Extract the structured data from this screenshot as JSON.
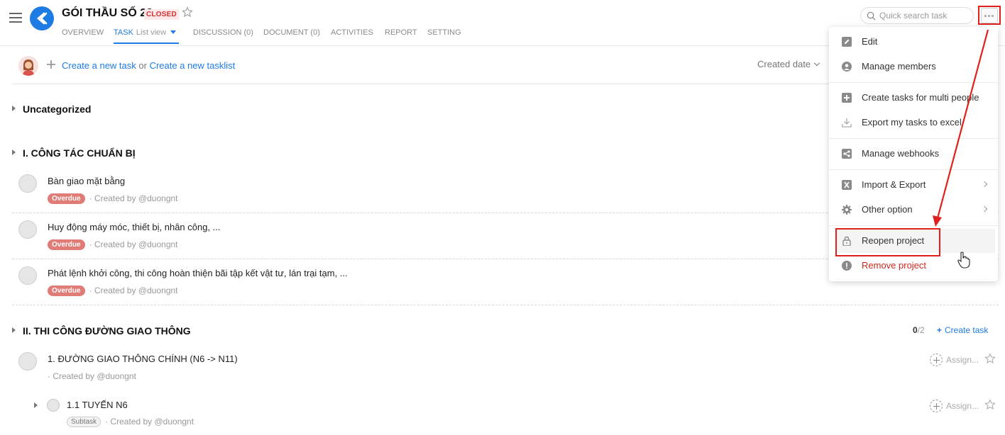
{
  "project": {
    "title": "GÓI THẦU SỐ 28",
    "status_badge": "CLOSED"
  },
  "nav": {
    "tabs": [
      {
        "label": "OVERVIEW"
      },
      {
        "label": "TASK",
        "sub": "List view",
        "active": true
      },
      {
        "label": "DISCUSSION (0)"
      },
      {
        "label": "DOCUMENT (0)"
      },
      {
        "label": "ACTIVITIES"
      },
      {
        "label": "REPORT"
      },
      {
        "label": "SETTING"
      }
    ]
  },
  "search": {
    "placeholder": "Quick search task"
  },
  "toolbar": {
    "create_task": "Create a new task",
    "or": "or",
    "create_tasklist": "Create a new tasklist",
    "sort_label": "Created date"
  },
  "groups": [
    {
      "title": "Uncategorized",
      "tasks": []
    },
    {
      "title": "I. CÔNG TÁC CHUẨN BỊ",
      "tasks": [
        {
          "name": "Bàn giao mặt bằng",
          "badge": "Overdue",
          "meta": "· Created by @duongnt"
        },
        {
          "name": "Huy động máy móc, thiết bị, nhân công, ...",
          "badge": "Overdue",
          "meta": "· Created by @duongnt"
        },
        {
          "name": "Phát lệnh khởi công, thi công hoàn thiện bãi tập kết vật tư, lán trại tạm, ...",
          "badge": "Overdue",
          "meta": "· Created by @duongnt"
        }
      ]
    },
    {
      "title": "II. THI CÔNG ĐƯỜNG GIAO THÔNG",
      "progress_done": "0",
      "progress_total": "/2",
      "create_task": "Create task",
      "tasks": [
        {
          "name": "1. ĐƯỜNG GIAO THÔNG CHÍNH (N6 -> N11)",
          "meta": "· Created by @duongnt",
          "assign": "Assign..."
        },
        {
          "name": "1.1 TUYẾN N6",
          "badge": "Subtask",
          "meta": "· Created by @duongnt",
          "assign": "Assign..."
        }
      ]
    }
  ],
  "menu": {
    "items": [
      {
        "label": "Edit",
        "icon": "pencil-icon"
      },
      {
        "label": "Manage members",
        "icon": "person-circle-icon"
      },
      {
        "label": "Create tasks for multi people",
        "icon": "plus-square-icon"
      },
      {
        "label": "Export my tasks to excel",
        "icon": "download-icon"
      },
      {
        "label": "Manage webhooks",
        "icon": "share-icon"
      },
      {
        "label": "Import & Export",
        "icon": "xls-icon"
      },
      {
        "label": "Other option",
        "icon": "gear-icon"
      },
      {
        "label": "Reopen project",
        "icon": "lock-icon"
      },
      {
        "label": "Remove project",
        "icon": "alert-icon"
      }
    ]
  },
  "colors": {
    "accent": "#1e7be3",
    "annotation_red": "#e0201b",
    "overdue": "#e07b76",
    "danger": "#d0281e"
  }
}
